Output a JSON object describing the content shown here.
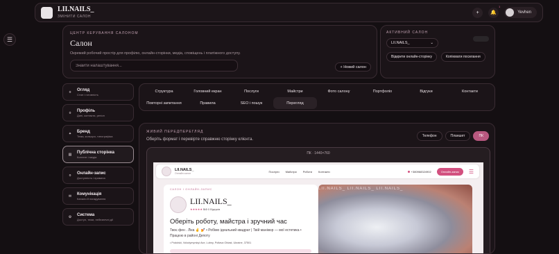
{
  "topbar": {
    "brand": "LII.NAILS_",
    "subtitle": "ЗМІНИТИ САЛОН",
    "username": "Yevhen",
    "notifications": "1",
    "add_symbol": "+"
  },
  "hero": {
    "eyebrow": "ЦЕНТР КЕРУВАННЯ САЛОНОМ",
    "title": "Салон",
    "description": "Окремий робочий простір для профілю, онлайн-сторінки, медіа, сповіщень і платіжного доступу.",
    "search_placeholder": "Знайти налаштування...",
    "new_button": "+ Новий салон"
  },
  "active_salon": {
    "eyebrow": "АКТИВНИЙ САЛОН",
    "selected": "LII.NAILS_",
    "open_page": "Відкрити онлайн-сторінку",
    "copy_link": "Копіювати посилання"
  },
  "sidebar": {
    "items": [
      {
        "title": "Огляд",
        "subtitle": "Стан і готовність",
        "icon": "o"
      },
      {
        "title": "Профіль",
        "subtitle": "Дані, контакти, регіон",
        "icon": "o"
      },
      {
        "title": "Бренд",
        "subtitle": "Тема, кольори, типографіка",
        "icon": "✦"
      },
      {
        "title": "Публічна сторінка",
        "subtitle": "Контент і медіа",
        "icon": "▤"
      },
      {
        "title": "Онлайн-запис",
        "subtitle": "Доступність і правила",
        "icon": "o"
      },
      {
        "title": "Комунікація",
        "subtitle": "Канали й нагадування",
        "icon": "✉"
      },
      {
        "title": "Система",
        "subtitle": "Доступ, теми, небезпечні дії",
        "icon": "⚙"
      }
    ]
  },
  "tabs": [
    "Структура",
    "Головний екран",
    "Послуги",
    "Майстри",
    "Фото салону",
    "Портфоліо",
    "Відгуки",
    "Контакти",
    "Повторні запитання",
    "Правила",
    "SEO і пошук",
    "Перегляд"
  ],
  "preview": {
    "eyebrow": "ЖИВИЙ ПЕРЕДПЕРЕГЛЯД",
    "description": "Оберіть формат і перевірте справжню сторінку клієнта.",
    "devices": [
      "Телефон",
      "Планшет",
      "ПК"
    ],
    "frame_label": "ПК · 1440×760"
  },
  "site": {
    "name": "LII.NAILS_",
    "tagline": "Онлайн салон",
    "links": [
      "Послуги",
      "Майстри",
      "Роботи",
      "Контакти"
    ],
    "phone": "+380968324902",
    "book": "Онлайн-запис",
    "eyebrow": "САЛОН І ОНЛАЙН-ЗАПИС",
    "brand": "LII.NAILS_",
    "rating": "5.0",
    "reviews": "0 Відгуків",
    "headline": "Оберіть роботу, майстра і зручний час",
    "text": "Твоє фен . Ліка ✌ 💅 • Робімо ідеальний квадрат | Твій манікюр — мої естетика • Працюю в районі Депоту",
    "address": "Podolski, Volodymyrskyi Ave, Lubny, Poltava Oblast, Ukraine, 37501",
    "photo_text": "LII.NAILS_ LII.NAILS_ LII.NAILS_"
  }
}
